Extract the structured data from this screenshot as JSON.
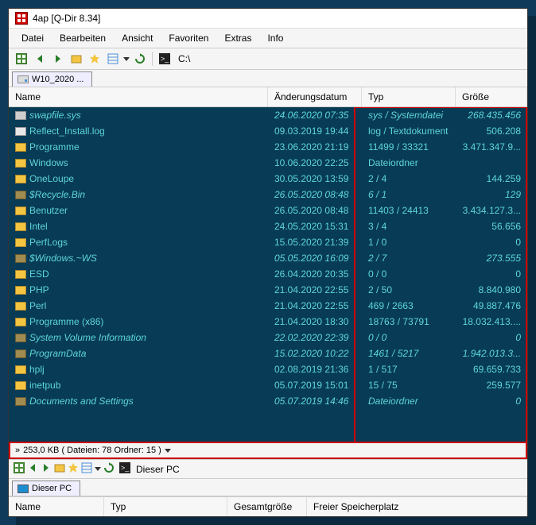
{
  "titlebar": {
    "title": "4ap  [Q-Dir 8.34]"
  },
  "menu": {
    "items": [
      "Datei",
      "Bearbeiten",
      "Ansicht",
      "Favoriten",
      "Extras",
      "Info"
    ]
  },
  "addressbar": {
    "path": "C:\\"
  },
  "tabs": {
    "top": {
      "label": "W10_2020 ..."
    },
    "bottom": {
      "label": "Dieser PC"
    }
  },
  "headers": {
    "name": "Name",
    "date": "Änderungsdatum",
    "type": "Typ",
    "size": "Größe"
  },
  "files": [
    {
      "icon": "file-sys",
      "italic": true,
      "name": "swapfile.sys",
      "date": "24.06.2020 07:35",
      "type": "sys / Systemdatei",
      "size": "268.435.456"
    },
    {
      "icon": "file",
      "italic": false,
      "name": "Reflect_Install.log",
      "date": "09.03.2019 19:44",
      "type": "log / Textdokument",
      "size": "506.208"
    },
    {
      "icon": "folder",
      "italic": false,
      "name": "Programme",
      "date": "23.06.2020 21:19",
      "type": "11499 / 33321",
      "size": "3.471.347.9..."
    },
    {
      "icon": "folder",
      "italic": false,
      "name": "Windows",
      "date": "10.06.2020 22:25",
      "type": "Dateiordner",
      "size": ""
    },
    {
      "icon": "folder",
      "italic": false,
      "name": "OneLoupe",
      "date": "30.05.2020 13:59",
      "type": "2 / 4",
      "size": "144.259"
    },
    {
      "icon": "folder-dim",
      "italic": true,
      "name": "$Recycle.Bin",
      "date": "26.05.2020 08:48",
      "type": "6 / 1",
      "size": "129"
    },
    {
      "icon": "folder",
      "italic": false,
      "name": "Benutzer",
      "date": "26.05.2020 08:48",
      "type": "11403 / 24413",
      "size": "3.434.127.3..."
    },
    {
      "icon": "folder",
      "italic": false,
      "name": "Intel",
      "date": "24.05.2020 15:31",
      "type": "3 / 4",
      "size": "56.656"
    },
    {
      "icon": "folder",
      "italic": false,
      "name": "PerfLogs",
      "date": "15.05.2020 21:39",
      "type": "1 / 0",
      "size": "0"
    },
    {
      "icon": "folder-dim",
      "italic": true,
      "name": "$Windows.~WS",
      "date": "05.05.2020 16:09",
      "type": "2 / 7",
      "size": "273.555"
    },
    {
      "icon": "folder",
      "italic": false,
      "name": "ESD",
      "date": "26.04.2020 20:35",
      "type": "0 / 0",
      "size": "0"
    },
    {
      "icon": "folder",
      "italic": false,
      "name": "PHP",
      "date": "21.04.2020 22:55",
      "type": "2 / 50",
      "size": "8.840.980"
    },
    {
      "icon": "folder",
      "italic": false,
      "name": "Perl",
      "date": "21.04.2020 22:55",
      "type": "469 / 2663",
      "size": "49.887.476"
    },
    {
      "icon": "folder",
      "italic": false,
      "name": "Programme (x86)",
      "date": "21.04.2020 18:30",
      "type": "18763 / 73791",
      "size": "18.032.413...."
    },
    {
      "icon": "folder-dim",
      "italic": true,
      "name": "System Volume Information",
      "date": "22.02.2020 22:39",
      "type": "0 / 0",
      "size": "0"
    },
    {
      "icon": "folder-dim",
      "italic": true,
      "name": "ProgramData",
      "date": "15.02.2020 10:22",
      "type": "1461 / 5217",
      "size": "1.942.013.3..."
    },
    {
      "icon": "folder",
      "italic": false,
      "name": "hplj",
      "date": "02.08.2019 21:36",
      "type": "1 / 517",
      "size": "69.659.733"
    },
    {
      "icon": "folder",
      "italic": false,
      "name": "inetpub",
      "date": "05.07.2019 15:01",
      "type": "15 / 75",
      "size": "259.577"
    },
    {
      "icon": "folder-dim",
      "italic": true,
      "name": "Documents and Settings",
      "date": "05.07.2019 14:46",
      "type": "Dateiordner",
      "size": "0"
    }
  ],
  "statusbar": {
    "text": "253,0 KB ( Dateien: 78 Ordner: 15  )"
  },
  "bottom_toolbar": {
    "addr": "Dieser PC"
  },
  "bottom_headers": {
    "name": "Name",
    "type": "Typ",
    "total": "Gesamtgröße",
    "free": "Freier Speicherplatz"
  }
}
